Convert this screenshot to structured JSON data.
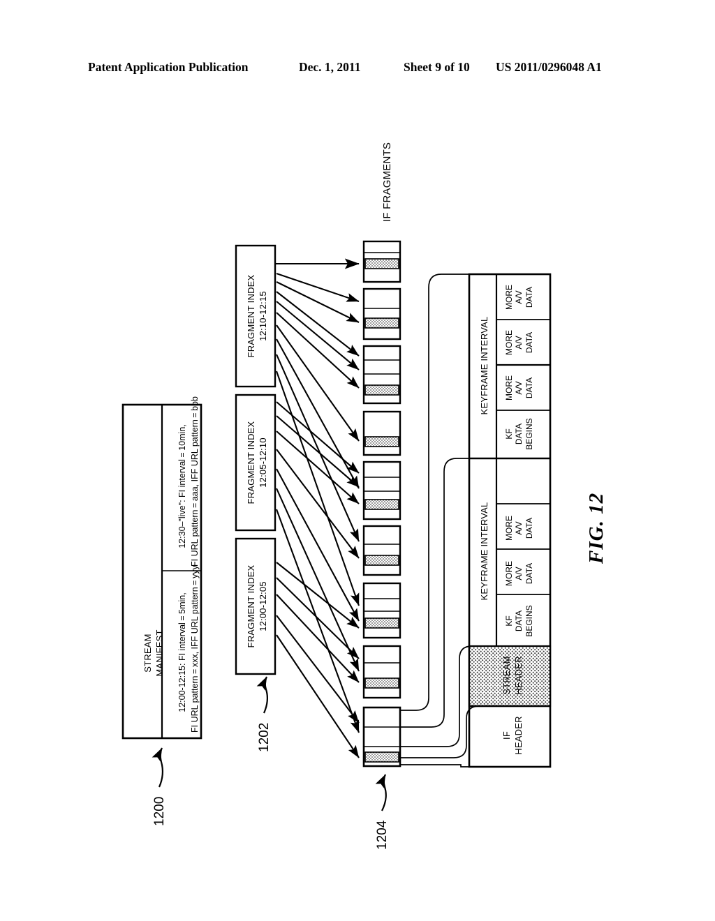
{
  "header": {
    "publication": "Patent Application Publication",
    "date": "Dec. 1, 2011",
    "sheet": "Sheet 9 of 10",
    "patent_number": "US 2011/0296048 A1"
  },
  "figure": {
    "label": "FIG. 12",
    "reference_numerals": [
      {
        "id": "1200",
        "target": "stream-manifest"
      },
      {
        "id": "1202",
        "target": "fragment-index-group"
      },
      {
        "id": "1204",
        "target": "if-fragment-detail"
      }
    ]
  },
  "stream_manifest": {
    "title_line1": "STREAM",
    "title_line2": "MANIFEST",
    "entries": [
      {
        "line1": "12:00-12:15: FI interval = 5min,",
        "line2": "FI URL pattern = xxx, IFF URL pattern = yyy"
      },
      {
        "line1": "12:30–\"live\": FI interval = 10min,",
        "line2": "FI URL pattern = aaa, IFF URL pattern = bbb"
      }
    ]
  },
  "fragment_indexes": [
    {
      "title": "FRAGMENT INDEX",
      "range": "12:00-12:05"
    },
    {
      "title": "FRAGMENT INDEX",
      "range": "12:05-12:10"
    },
    {
      "title": "FRAGMENT INDEX",
      "range": "12:10-12:15"
    }
  ],
  "if_fragments": {
    "label": "IF FRAGMENTS",
    "count": 9
  },
  "fragment_detail": {
    "if_header": {
      "line1": "IF",
      "line2": "HEADER"
    },
    "stream_header": {
      "line1": "STREAM",
      "line2": "HEADER"
    },
    "keyframe_intervals": [
      {
        "label": "KEYFRAME INTERVAL",
        "cells": [
          {
            "line1": "KF",
            "line2": "DATA",
            "line3": "BEGINS"
          },
          {
            "line1": "MORE",
            "line2": "A/V",
            "line3": "DATA"
          },
          {
            "line1": "MORE",
            "line2": "A/V",
            "line3": "DATA"
          }
        ]
      },
      {
        "label": "KEYFRAME INTERVAL",
        "cells": [
          {
            "line1": "KF",
            "line2": "DATA",
            "line3": "BEGINS"
          },
          {
            "line1": "MORE",
            "line2": "A/V",
            "line3": "DATA"
          },
          {
            "line1": "MORE",
            "line2": "A/V",
            "line3": "DATA"
          },
          {
            "line1": "MORE",
            "line2": "A/V",
            "line3": "DATA"
          }
        ]
      }
    ]
  },
  "colors": {
    "ink": "#000000",
    "paper": "#ffffff",
    "stipple": "#9a9a9a"
  }
}
